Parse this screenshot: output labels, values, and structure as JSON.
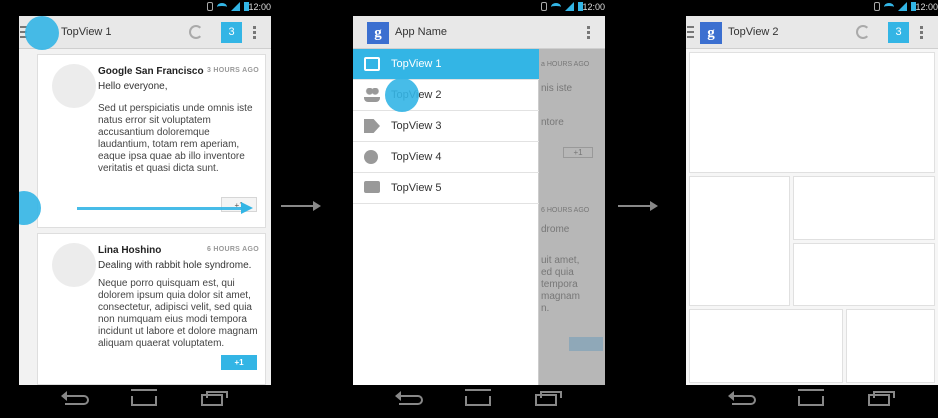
{
  "status_bar": {
    "time": "12:00"
  },
  "phone1": {
    "title": "TopView 1",
    "count": "3",
    "posts": [
      {
        "author": "Google San Francisco",
        "time": "3 HOURS AGO",
        "lead": "Hello everyone,",
        "body": "Sed ut perspiciatis unde omnis iste natus error sit voluptatem accusantium doloremque laudantium, totam rem aperiam, eaque ipsa quae ab illo inventore veritatis et quasi dicta sunt.",
        "plus": "+1"
      },
      {
        "author": "Lina Hoshino",
        "time": "6 HOURS AGO",
        "lead": "Dealing with rabbit hole syndrome.",
        "body": "Neque porro quisquam est, qui dolorem ipsum quia dolor sit amet, consectetur, adipisci velit, sed quia non numquam eius modi tempora incidunt ut labore et dolore magnam aliquam quaerat voluptatem.",
        "plus": "+1"
      }
    ]
  },
  "phone2": {
    "app_name": "App Name",
    "drawer_items": [
      {
        "label": "TopView 1",
        "icon": "inbox-icon",
        "selected": true
      },
      {
        "label": "TopView 2",
        "icon": "people-icon"
      },
      {
        "label": "TopView 3",
        "icon": "tag-icon"
      },
      {
        "label": "TopView 4",
        "icon": "info-icon"
      },
      {
        "label": "TopView 5",
        "icon": "chat-icon"
      }
    ],
    "behind_fragments": [
      "a HOURS AGO",
      "nis iste",
      "ntore",
      "+1",
      "6 HOURS AGO",
      "drome",
      "uit amet,",
      "ed quia",
      "tempora",
      "magnam",
      "n."
    ]
  },
  "phone3": {
    "title": "TopView 2",
    "count": "3"
  },
  "colors": {
    "accent": "#33b5e5",
    "actionbar": "#e8e8e8",
    "background": "#000000"
  }
}
